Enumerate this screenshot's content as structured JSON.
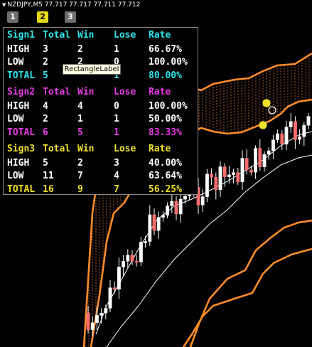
{
  "header": {
    "text": "NZDJPY,M5  77.717 77.717 77.711 77.712"
  },
  "tabs": [
    {
      "label": "2",
      "active": true
    },
    {
      "label": "3",
      "active": false
    }
  ],
  "tooltip": {
    "text": "RectangleLabel"
  },
  "colors": {
    "cyan": "#2fe6ea",
    "magenta": "#e83ce6",
    "yellow": "#f2e22a",
    "white": "#ffffff",
    "band": "#ff8c2a",
    "bull": "#ffffff",
    "bear": "#ff6e6e"
  },
  "stats": {
    "headers": [
      "Total",
      "Win",
      "Lose",
      "Rate"
    ],
    "sections": [
      {
        "name": "Sign1",
        "color": "cyan",
        "rows": [
          {
            "label": "HIGH",
            "total": "3",
            "win": "2",
            "lose": "1",
            "rate": "66.67%",
            "color": "white"
          },
          {
            "label": "LOW",
            "total": "2",
            "win": "2",
            "lose": "0",
            "rate": "100.00%",
            "color": "white"
          },
          {
            "label": "TOTAL",
            "total": "5",
            "win": "",
            "lose": "1",
            "rate": "80.00%",
            "color": "cyan"
          }
        ]
      },
      {
        "name": "Sign2",
        "color": "magenta",
        "rows": [
          {
            "label": "HIGH",
            "total": "4",
            "win": "4",
            "lose": "0",
            "rate": "100.00%",
            "color": "white"
          },
          {
            "label": "LOW",
            "total": "2",
            "win": "1",
            "lose": "1",
            "rate": "50.00%",
            "color": "white"
          },
          {
            "label": "TOTAL",
            "total": "6",
            "win": "5",
            "lose": "1",
            "rate": "83.33%",
            "color": "magenta"
          }
        ]
      },
      {
        "name": "Sign3",
        "color": "yellow",
        "rows": [
          {
            "label": "HIGH",
            "total": "5",
            "win": "2",
            "lose": "3",
            "rate": "40.00%",
            "color": "white"
          },
          {
            "label": "LOW",
            "total": "11",
            "win": "7",
            "lose": "4",
            "rate": "63.64%",
            "color": "white"
          },
          {
            "label": "TOTAL",
            "total": "16",
            "win": "9",
            "lose": "7",
            "rate": "56.25%",
            "color": "yellow"
          }
        ]
      }
    ]
  }
}
